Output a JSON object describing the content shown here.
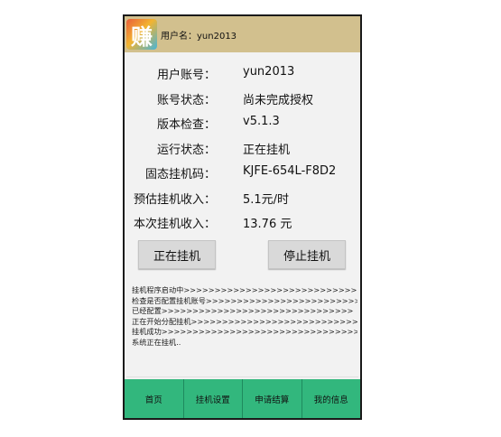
{
  "header": {
    "app_icon_char": "赚",
    "title": "用户名：yun2013"
  },
  "info_rows": [
    {
      "label": "用户账号：",
      "value": "yun2013"
    },
    {
      "label": "账号状态：",
      "value": "尚未完成授权"
    },
    {
      "label": "版本检查：",
      "value": "v5.1.3"
    },
    {
      "label": "运行状态：",
      "value": "正在挂机"
    },
    {
      "label": "固态挂机码：",
      "value": "KJFE-654L-F8D2"
    },
    {
      "label": "预估挂机收入：",
      "value": "5.1元/时"
    },
    {
      "label": "本次挂机收入：",
      "value": "13.76 元"
    }
  ],
  "buttons": {
    "start": "正在挂机",
    "stop": "停止挂机"
  },
  "log_lines": [
    "挂机程序启动中>>>>>>>>>>>>>>>>>>>>>>>>>>>>>",
    "检查是否配置挂机账号>>>>>>>>>>>>>>>>>>>>>>>>>",
    "已经配置>>>>>>>>>>>>>>>>>>>>>>>>>>>>>>>",
    "正在开始分配挂机>>>>>>>>>>>>>>>>>>>>>>>>>>>>>>",
    "挂机成功>>>>>>>>>>>>>>>>>>>>>>>>>>>>>>>>",
    "系统正在挂机.."
  ],
  "tabs": [
    "首页",
    "挂机设置",
    "申请结算",
    "我的信息"
  ],
  "colors": {
    "title_bar": "#d2c08e",
    "tab_bar": "#32b77d"
  }
}
